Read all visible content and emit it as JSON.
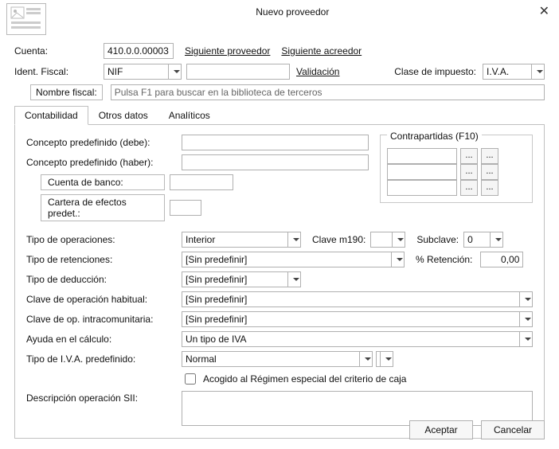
{
  "title": "Nuevo proveedor",
  "close_char": "✕",
  "top": {
    "cuenta_label": "Cuenta:",
    "cuenta_value": "410.0.0.00003",
    "link_sig_prov": "Siguiente proveedor",
    "link_sig_acr": "Siguiente acreedor",
    "ident_fiscal_label": "Ident. Fiscal:",
    "ident_fiscal_options": [
      "NIF"
    ],
    "ident_fiscal_selected": "NIF",
    "ident_value": "",
    "validacion_link": "Validación",
    "clase_impuesto_label": "Clase de impuesto:",
    "clase_impuesto_selected": "I.V.A.",
    "nombre_fiscal_button": "Nombre fiscal:",
    "nombre_fiscal_placeholder": "Pulsa F1 para buscar en la biblioteca de terceros"
  },
  "tabs": {
    "contabilidad": "Contabilidad",
    "otros_datos": "Otros datos",
    "analiticos": "Analíticos"
  },
  "pane": {
    "concepto_debe_label": "Concepto predefinido (debe):",
    "concepto_debe_value": "",
    "concepto_haber_label": "Concepto predefinido (haber):",
    "concepto_haber_value": "",
    "cuenta_banco_btn": "Cuenta de banco:",
    "cuenta_banco_value": "",
    "cartera_efectos_btn": "Cartera de efectos predet.:",
    "cartera_efectos_value": "",
    "contrapartidas_title": "Contrapartidas (F10)",
    "contrap_rows": [
      {
        "v": ""
      },
      {
        "v": ""
      },
      {
        "v": ""
      }
    ],
    "little_btn": "...",
    "tipo_operaciones_label": "Tipo de operaciones:",
    "tipo_operaciones_selected": "Interior",
    "clave_m190_label": "Clave m190:",
    "clave_m190_value": "",
    "subclave_label": "Subclave:",
    "subclave_value": "0",
    "tipo_retenciones_label": "Tipo de retenciones:",
    "tipo_retenciones_selected": "[Sin predefinir]",
    "pct_retencion_label": "% Retención:",
    "pct_retencion_value": "0,00",
    "tipo_deduccion_label": "Tipo de deducción:",
    "tipo_deduccion_selected": "[Sin predefinir]",
    "clave_op_habitual_label": "Clave de operación habitual:",
    "clave_op_habitual_selected": "[Sin predefinir]",
    "clave_op_intracom_label": "Clave de op. intracomunitaria:",
    "clave_op_intracom_selected": "[Sin predefinir]",
    "ayuda_calculo_label": "Ayuda en el cálculo:",
    "ayuda_calculo_selected": "Un tipo de IVA",
    "tipo_iva_predef_label": "Tipo de I.V.A. predefinido:",
    "tipo_iva_predef_selected": "Normal",
    "checkbox_label": "Acogido al Régimen especial del criterio de caja",
    "descripcion_sii_label": "Descripción operación SII:",
    "descripcion_sii_value": ""
  },
  "buttons": {
    "accept": "Aceptar",
    "cancel": "Cancelar"
  }
}
